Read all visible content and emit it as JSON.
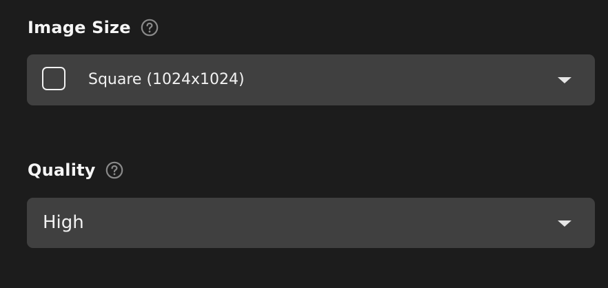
{
  "image_size": {
    "label": "Image Size",
    "help_icon": "question-circle-icon",
    "selected_icon": "square-icon",
    "selected_value": "Square (1024x1024)",
    "dropdown_icon": "chevron-down-icon"
  },
  "quality": {
    "label": "Quality",
    "help_icon": "question-circle-icon",
    "selected_value": "High",
    "dropdown_icon": "chevron-down-icon"
  },
  "colors": {
    "background": "#1c1c1c",
    "field_background": "#404040",
    "text": "#f2f2f2",
    "icon": "#8a8a8a"
  }
}
